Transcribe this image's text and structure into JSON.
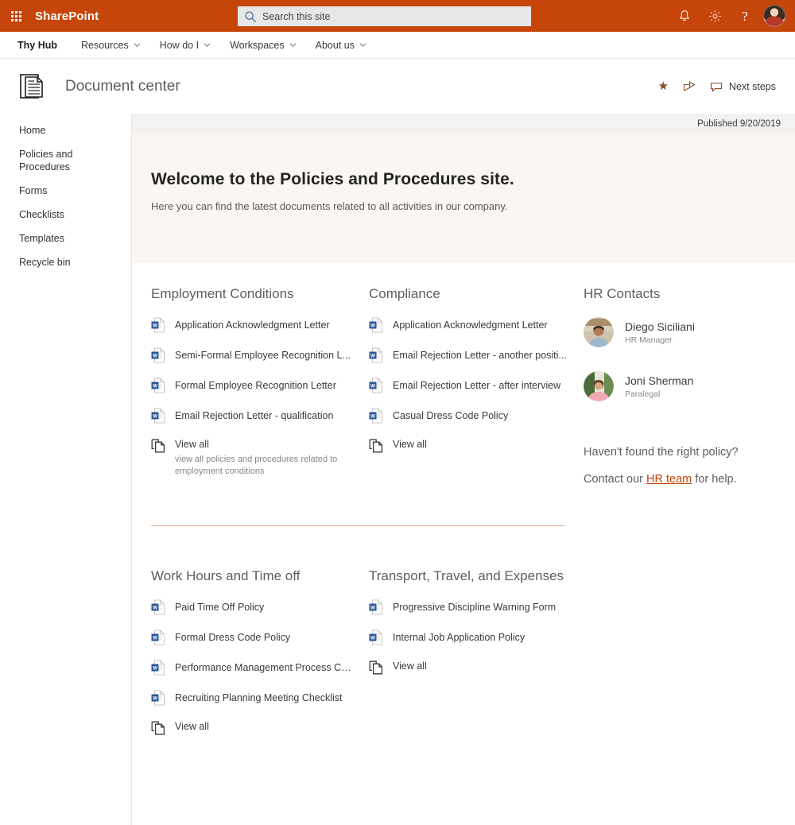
{
  "suite": {
    "waffle_label": "app-launcher",
    "brand": "SharePoint",
    "search": {
      "placeholder": "Search this site",
      "value": ""
    },
    "notifications_label": "Notifications",
    "settings_label": "Settings",
    "help_label": "?",
    "account_label": "Account manager",
    "bar_color": "#C6450A"
  },
  "hubnav": {
    "hub_title": "Thy Hub",
    "items": [
      {
        "label": "Resources"
      },
      {
        "label": "How do I"
      },
      {
        "label": "Workspaces"
      },
      {
        "label": "About us"
      }
    ]
  },
  "siteheader": {
    "logo_name": "document-center-logo",
    "title": "Document center",
    "actions": [
      {
        "name": "favorite",
        "icon": "star-icon",
        "label": ""
      },
      {
        "name": "share",
        "icon": "share-icon",
        "label": ""
      },
      {
        "name": "next-steps",
        "icon": "comment-icon",
        "label": "Next steps"
      }
    ]
  },
  "leftnav": {
    "items": [
      {
        "label": "Home"
      },
      {
        "label": "Policies and Procedures"
      },
      {
        "label": "Forms"
      },
      {
        "label": "Checklists"
      },
      {
        "label": "Templates"
      },
      {
        "label": "Recycle bin"
      }
    ]
  },
  "published": "Published 9/20/2019",
  "hero": {
    "heading": "Welcome to the Policies and Procedures site.",
    "subheading": "Here you can find the latest documents related to all activities in our company.",
    "bg_color": "#fbf6f1"
  },
  "sections": {
    "employment": {
      "title": "Employment Conditions",
      "docs": [
        {
          "label": "Application Acknowledgment Letter",
          "icon": "word-doc-icon"
        },
        {
          "label": "Semi-Formal Employee Recognition L...",
          "icon": "word-doc-icon"
        },
        {
          "label": "Formal Employee Recognition Letter",
          "icon": "word-doc-icon"
        },
        {
          "label": "Email Rejection Letter - qualification",
          "icon": "word-doc-icon"
        }
      ],
      "view_all": {
        "label": "View all",
        "sub": "view all policies and procedures related to employment conditions"
      }
    },
    "compliance": {
      "title": "Compliance",
      "docs": [
        {
          "label": "Application Acknowledgment Letter",
          "icon": "word-doc-icon"
        },
        {
          "label": "Email Rejection Letter - another positi...",
          "icon": "word-doc-icon"
        },
        {
          "label": "Email Rejection Letter - after interview",
          "icon": "word-doc-icon"
        },
        {
          "label": "Casual Dress Code Policy",
          "icon": "word-doc-icon"
        }
      ],
      "view_all": {
        "label": "View all",
        "sub": ""
      }
    },
    "hr_contacts": {
      "title": "HR Contacts",
      "people": [
        {
          "name": "Diego Siciliani",
          "role": "HR Manager"
        },
        {
          "name": "Joni Sherman",
          "role": "Paralegal"
        }
      ],
      "help_question": "Haven't found the right policy?",
      "help_prefix": "Contact our ",
      "help_link": "HR team",
      "help_suffix": " for help.",
      "link_color": "#C6450A"
    },
    "work_hours": {
      "title": "Work Hours and Time off",
      "docs": [
        {
          "label": "Paid Time Off Policy",
          "icon": "word-doc-icon"
        },
        {
          "label": "Formal Dress Code Policy",
          "icon": "word-doc-icon"
        },
        {
          "label": "Performance Management Process Ch...",
          "icon": "word-doc-icon"
        },
        {
          "label": "Recruiting Planning Meeting Checklist",
          "icon": "word-doc-icon"
        }
      ],
      "view_all": {
        "label": "View all",
        "sub": ""
      }
    },
    "transport": {
      "title": "Transport, Travel, and Expenses",
      "docs": [
        {
          "label": "Progressive Discipline Warning Form",
          "icon": "word-doc-icon"
        },
        {
          "label": "Internal Job Application Policy",
          "icon": "word-doc-icon"
        }
      ],
      "view_all": {
        "label": "View all",
        "sub": ""
      }
    }
  }
}
